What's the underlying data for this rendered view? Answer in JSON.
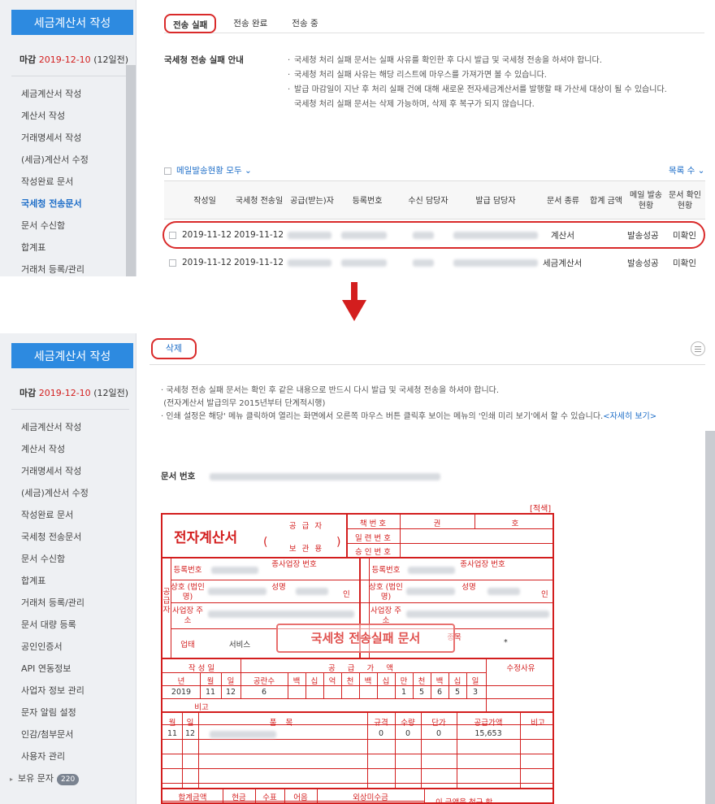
{
  "sidebar": {
    "create_button": "세금계산서 작성",
    "deadline": {
      "label": "마감",
      "date": "2019-12-10",
      "remaining": "(12일전)"
    },
    "menu_top": [
      "세금계산서 작성",
      "계산서 작성",
      "거래명세서 작성",
      "(세금)계산서 수정",
      "작성완료 문서",
      "국세청 전송문서",
      "문서 수신함",
      "합계표",
      "거래처 등록/관리"
    ],
    "menu_bottom": [
      "세금계산서 작성",
      "계산서 작성",
      "거래명세서 작성",
      "(세금)계산서 수정",
      "작성완료 문서",
      "국세청 전송문서",
      "문서 수신함",
      "합계표",
      "거래처 등록/관리",
      "문서 대량 등록",
      "공인인증서",
      "API 연동정보",
      "사업자 정보 관리",
      "문자 알림 설정",
      "인감/첨부문서",
      "사용자 관리"
    ],
    "bubble_item": {
      "label": "보유 문자",
      "count": "220"
    }
  },
  "tabs": [
    "전송 실패",
    "전송 완료",
    "전송 중"
  ],
  "notice": {
    "title": "국세청 전송 실패 안내",
    "lines": [
      "국세청 처리 실패 문서는 실패 사유를 확인한 후 다시 발급 및 국세청 전송을 하셔야 합니다.",
      "국세청 처리 실패 사유는 해당 리스트에 마우스를 가져가면 볼 수 있습니다.",
      "발급 마감일이 지난 후 처리 실패 건에 대해 새로운 전자세금계산서를 발행할 때 가산세 대상이 될 수 있습니다.",
      "국세청 처리 실패 문서는 삭제 가능하며, 삭제 후 복구가 되지 않습니다."
    ]
  },
  "list": {
    "mail_filter": "메일발송현황 모두",
    "list_count": "목록 수",
    "headers": [
      "작성일",
      "국세청 전송일",
      "공급(받는)자",
      "등록번호",
      "수신 담당자",
      "발급 담당자",
      "문서 종류",
      "합계 금액",
      "메일 발송 현황",
      "문서 확인 현황"
    ],
    "rows": [
      {
        "date": "2019-11-12",
        "sent": "2019-11-12",
        "type": "계산서",
        "mail": "발송성공",
        "confirm": "미확인"
      },
      {
        "date": "2019-11-12",
        "sent": "2019-11-12",
        "type": "세금계산서",
        "mail": "발송성공",
        "confirm": "미확인"
      }
    ]
  },
  "detail": {
    "delete_button": "삭제",
    "notes": [
      "국세청 전송 실패 문서는 확인 후 같은 내용으로 반드시 다시 발급 및 국세청 전송을 하셔야 합니다.",
      "(전자계산서 발급의무 2015년부터 단계적시행)",
      "인쇄 설정은 해당' 메뉴 클릭하여 열리는 화면에서 오른쪽 마우스 버튼 클릭후 보이는 메뉴의 '인쇄 미리 보기'에서 할 수 있습니다."
    ],
    "more_link": "<자세히 보기>",
    "doc_no_label": "문서 번호",
    "copy_label": "[적색]"
  },
  "invoice": {
    "title": "전자계산서",
    "supplier_kind": "공 급 자",
    "keep": "보 관 용",
    "paren_open": "(",
    "paren_close": ")",
    "book_no": "책 번 호",
    "gwon": "권",
    "ho": "호",
    "serial": "일 련 번 호",
    "approval": "승 인 번 호",
    "reg_no": "등록번호",
    "sub_biz": "종사업장 번호",
    "name": "상호 (법인명)",
    "ceo": "성명",
    "in": "인",
    "addr": "사업장 주소",
    "biz_type": "업태",
    "biz_type_val": "서비스",
    "item_type": "종목",
    "item_star": "*",
    "supplier_side": "공급자",
    "stamp": "국세청 전송실패 문서",
    "date_hdr": "작 성 일",
    "amount_hdr": "공 급 가 액",
    "reason_hdr": "수정사유",
    "ymd": [
      "년",
      "월",
      "일"
    ],
    "blank": "공란수",
    "digits": [
      "백",
      "십",
      "억",
      "천",
      "백",
      "십",
      "만",
      "천",
      "백",
      "십",
      "일"
    ],
    "date_vals": [
      "2019",
      "11",
      "12"
    ],
    "blank_val": "6",
    "amount_digits": [
      "1",
      "5",
      "6",
      "5",
      "3"
    ],
    "memo": "비고",
    "item_headers": [
      "월",
      "일",
      "품 목",
      "규격",
      "수량",
      "단가",
      "공급가액",
      "비고"
    ],
    "item_row": {
      "m": "11",
      "d": "12",
      "spec": "0",
      "qty": "0",
      "price": "0",
      "amount": "15,653"
    },
    "total_headers": [
      "합계금액",
      "현금",
      "수표",
      "어음",
      "외상미수금"
    ],
    "claim": "이 금액을 청구 함"
  }
}
